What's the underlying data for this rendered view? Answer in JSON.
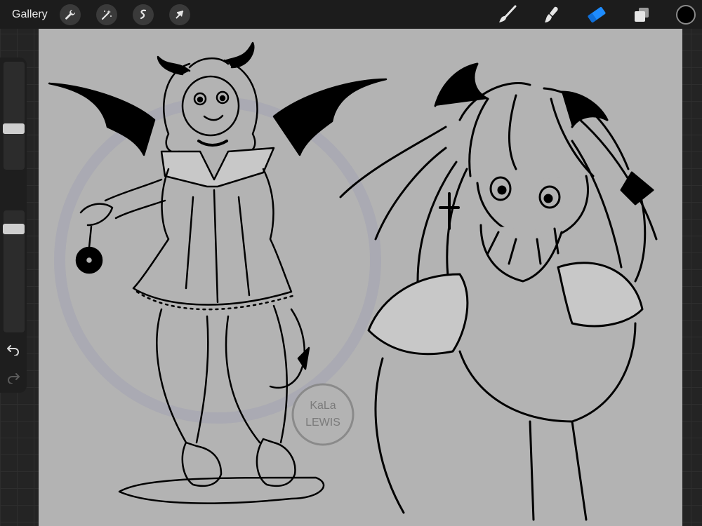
{
  "app": {
    "gallery_label": "Gallery",
    "actions": [
      {
        "icon": "wrench-icon"
      },
      {
        "icon": "magic-wand-icon"
      },
      {
        "icon": "selection-icon"
      },
      {
        "icon": "transform-arrow-icon"
      }
    ],
    "tools": [
      {
        "icon": "brush-icon",
        "active": false
      },
      {
        "icon": "smudge-icon",
        "active": false
      },
      {
        "icon": "eraser-icon",
        "active": true
      },
      {
        "icon": "layers-icon",
        "active": false
      }
    ],
    "current_color": "#000000",
    "accent_color": "#1e8cff"
  },
  "canvas": {
    "watermark": {
      "line1": "KaLa",
      "line2": "LEWIS"
    }
  }
}
